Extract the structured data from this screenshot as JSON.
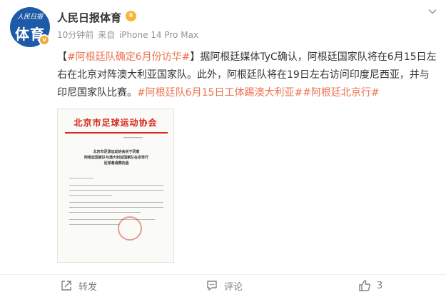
{
  "account": {
    "name": "人民日报体育",
    "avatar_top": "人民日报",
    "avatar_main": "体育",
    "verified_badge": "v",
    "meta_time": "10分钟前",
    "meta_source_prefix": "来自",
    "meta_source": "iPhone 14 Pro Max"
  },
  "post": {
    "bracket_open": "【",
    "title_tag": "#阿根廷队确定6月份访华#",
    "bracket_close": "】",
    "body": "据阿根廷媒体TyC确认，阿根廷国家队将在6月15日左右在北京对阵澳大利亚国家队。此外，阿根廷队将在19日左右访问印度尼西亚，并与印尼国家队比赛。",
    "tag_2": "#阿根廷队6月15日工体踢澳大利亚#",
    "tag_3": "#阿根廷北京行#"
  },
  "document_image": {
    "title": "北京市足球运动协会",
    "heading_line_1": "北京市足球运动协会关于同意",
    "heading_line_2": "阿根廷国家队与澳大利亚国家队在京举行",
    "heading_line_3": "足球邀请赛的函"
  },
  "actions": {
    "repost_label": "转发",
    "comment_label": "评论",
    "like_count": "3"
  },
  "colors": {
    "tag": "#eb7350",
    "document_red": "#d8261b",
    "avatar_blue": "#1d5aa8",
    "muted": "#939393"
  }
}
